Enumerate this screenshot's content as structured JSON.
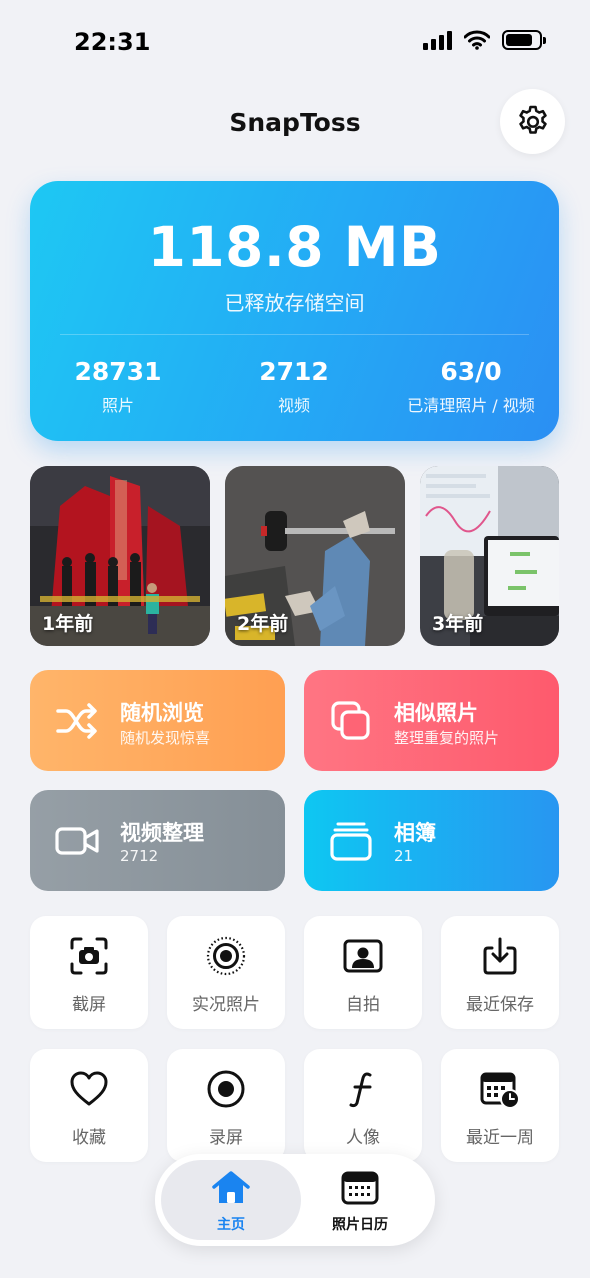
{
  "status_bar": {
    "time": "22:31",
    "battery_level": 0.8
  },
  "header": {
    "title": "SnapToss",
    "settings_icon": "gear-icon"
  },
  "stats": {
    "freed_size": "118.8 MB",
    "freed_label": "已释放存储空间",
    "items": [
      {
        "value": "28731",
        "label": "照片"
      },
      {
        "value": "2712",
        "label": "视频"
      },
      {
        "value": "63/0",
        "label": "已清理照片 / 视频"
      }
    ]
  },
  "memories": [
    {
      "label": "1年前"
    },
    {
      "label": "2年前"
    },
    {
      "label": "3年前"
    }
  ],
  "features": [
    {
      "title": "随机浏览",
      "subtitle": "随机发现惊喜",
      "icon": "shuffle-icon",
      "color": "#ffa45c"
    },
    {
      "title": "相似照片",
      "subtitle": "整理重复的照片",
      "icon": "duplicate-icon",
      "color": "#fe6475"
    },
    {
      "title": "视频整理",
      "subtitle": "2712",
      "icon": "video-camera-icon",
      "color": "#8c969e"
    },
    {
      "title": "相簿",
      "subtitle": "21",
      "icon": "albums-icon",
      "color": "#1ea6f3"
    }
  ],
  "albums": [
    {
      "label": "截屏",
      "icon": "screenshot-icon"
    },
    {
      "label": "实况照片",
      "icon": "live-photo-icon"
    },
    {
      "label": "自拍",
      "icon": "selfie-icon"
    },
    {
      "label": "最近保存",
      "icon": "download-icon"
    },
    {
      "label": "收藏",
      "icon": "heart-icon"
    },
    {
      "label": "录屏",
      "icon": "record-icon"
    },
    {
      "label": "人像",
      "icon": "portrait-f-icon"
    },
    {
      "label": "最近一周",
      "icon": "calendar-clock-icon"
    }
  ],
  "tabbar": {
    "tabs": [
      {
        "label": "主页",
        "icon": "home-icon",
        "active": true,
        "color": "#1a84f0"
      },
      {
        "label": "照片日历",
        "icon": "calendar-icon",
        "active": false,
        "color": "#111111"
      }
    ]
  }
}
